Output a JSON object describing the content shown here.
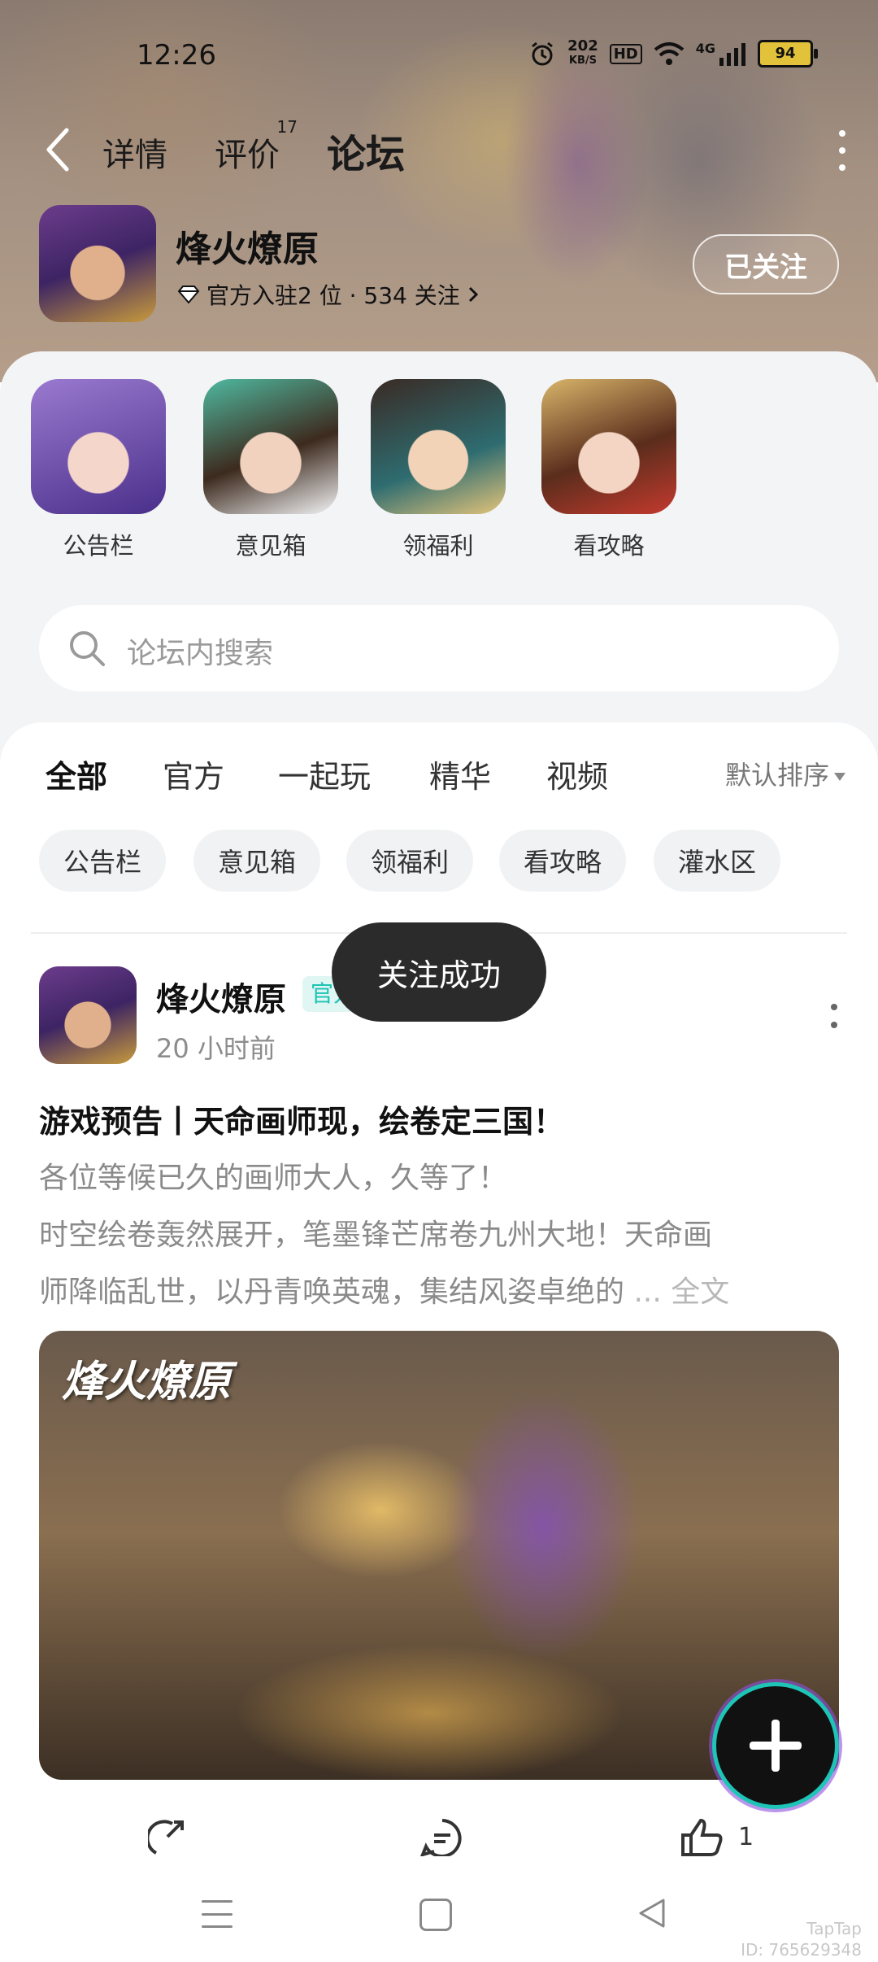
{
  "status_bar": {
    "time": "12:26",
    "net_speed_top": "202",
    "net_speed_unit": "KB/S",
    "hd": "HD",
    "signal": "4G",
    "battery": "94"
  },
  "nav": {
    "tabs": [
      "详情",
      "评价",
      "论坛"
    ],
    "review_count": "17",
    "active_tab": "论坛"
  },
  "game": {
    "name": "烽火燎原",
    "meta": "官方入驻2 位 · 534 关注",
    "follow_label": "已关注"
  },
  "shortcuts": [
    {
      "label": "公告栏"
    },
    {
      "label": "意见箱"
    },
    {
      "label": "领福利"
    },
    {
      "label": "看攻略"
    }
  ],
  "search": {
    "placeholder": "论坛内搜索"
  },
  "categories": [
    "全部",
    "官方",
    "一起玩",
    "精华",
    "视频"
  ],
  "sort_label": "默认排序",
  "chips": [
    "公告栏",
    "意见箱",
    "领福利",
    "看攻略",
    "灌水区"
  ],
  "toast": "关注成功",
  "post": {
    "author": "烽火燎原",
    "badge": "官方",
    "time": "20 小时前",
    "title": "游戏预告丨天命画师现，绘卷定三国！",
    "body_line1": "各位等候已久的画师大人，久等了！",
    "body_line2": "时空绘卷轰然展开，笔墨锋芒席卷九州大地！天命画",
    "body_line3": "师降临乱世，以丹青唤英魂，集结风姿卓绝的",
    "more_label": "... 全文",
    "image_logo": "烽火燎原",
    "like_count": "1"
  },
  "watermark": {
    "brand": "TapTap",
    "id": "ID: 765629348"
  },
  "colors": {
    "accent": "#1ec4b5",
    "toast_bg": "#2b2b2b"
  }
}
